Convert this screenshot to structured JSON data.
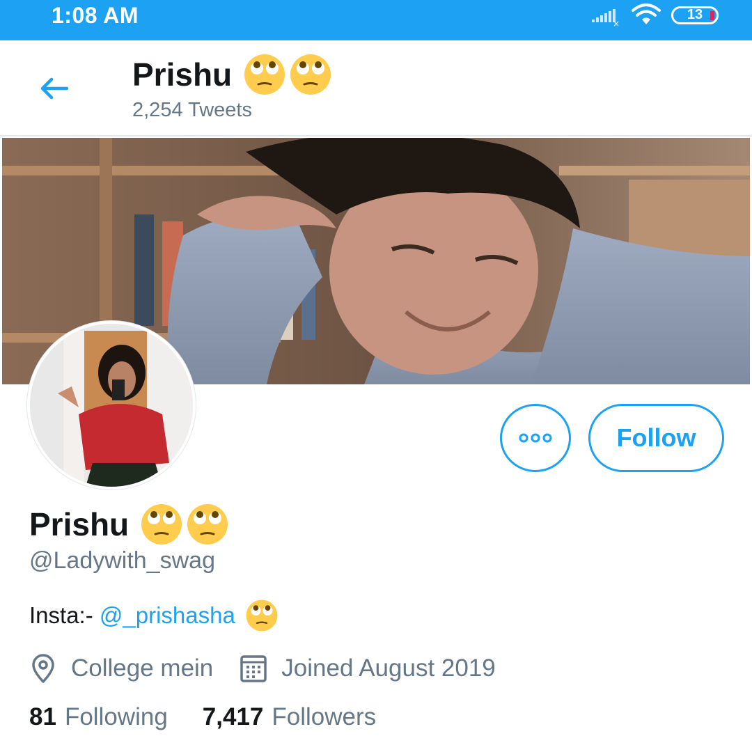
{
  "status_bar": {
    "time": "1:08 AM",
    "battery": "13",
    "icons": [
      "signal-icon",
      "wifi-icon",
      "battery-icon"
    ],
    "background": "#1da1f2"
  },
  "header": {
    "title": "Prishu",
    "tweets_count": "2,254 Tweets",
    "icons": [
      "back-arrow-icon",
      "rolling-eyes-emoji"
    ]
  },
  "banner": {
    "description": "profile-banner-photo"
  },
  "actions": {
    "more_icon": "more-options-icon",
    "follow_label": "Follow"
  },
  "profile": {
    "name": "Prishu",
    "handle": "@Ladywith_swag",
    "bio_prefix": "Insta:- ",
    "bio_link": "@_prishasha",
    "location": "College mein",
    "joined": "Joined August 2019",
    "following_count": "81",
    "following_label": "Following",
    "followers_count": "7,417",
    "followers_label": "Followers"
  },
  "colors": {
    "accent": "#1da1f2",
    "text_primary": "#14171a",
    "text_secondary": "#657786",
    "divider": "#e1e8ed"
  }
}
